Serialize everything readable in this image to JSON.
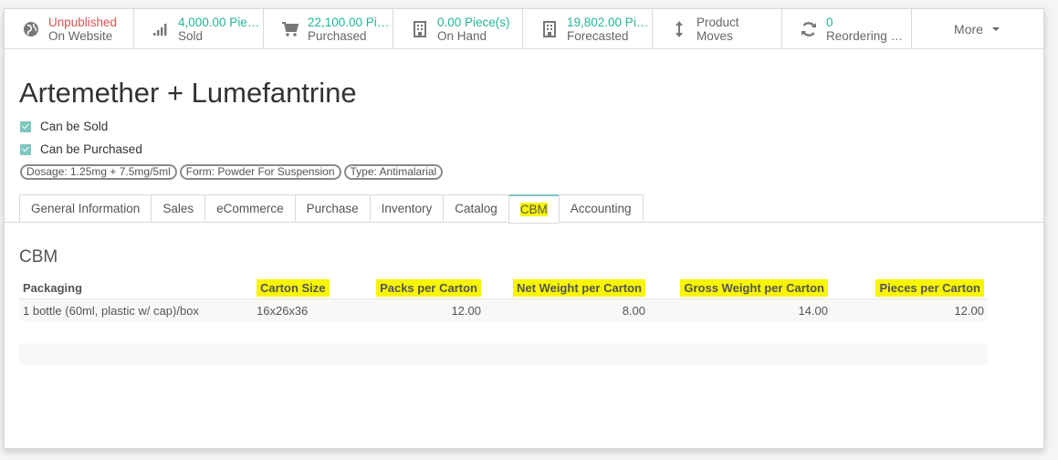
{
  "smart_buttons": [
    {
      "value": "Unpublished",
      "label": "On Website",
      "icon": "globe-icon",
      "value_color": "red"
    },
    {
      "value": "4,000.00 Piec…",
      "label": "Sold",
      "icon": "signal-icon",
      "value_color": "green"
    },
    {
      "value": "22,100.00 Pie…",
      "label": "Purchased",
      "icon": "cart-icon",
      "value_color": "green"
    },
    {
      "value": "0.00 Piece(s)",
      "label": "On Hand",
      "icon": "building-icon",
      "value_color": "green"
    },
    {
      "value": "19,802.00 Pie…",
      "label": "Forecasted",
      "icon": "building-icon",
      "value_color": "green"
    },
    {
      "value": "Product",
      "label": "Moves",
      "icon": "arrows-vertical-icon",
      "value_color": "grey"
    },
    {
      "value": "0",
      "label": "Reordering R…",
      "icon": "refresh-icon",
      "value_color": "green"
    }
  ],
  "more_label": "More",
  "product": {
    "name": "Artemether + Lumefantrine",
    "can_be_sold": "Can be Sold",
    "can_be_purchased": "Can be Purchased",
    "tags": [
      "Dosage: 1.25mg + 7.5mg/5ml",
      "Form: Powder For Suspension",
      "Type: Antimalarial"
    ]
  },
  "tabs": [
    "General Information",
    "Sales",
    "eCommerce",
    "Purchase",
    "Inventory",
    "Catalog",
    "CBM",
    "Accounting"
  ],
  "active_tab": "CBM",
  "cbm": {
    "section_title": "CBM",
    "headers": [
      "Packaging",
      "Carton Size",
      "Packs per Carton",
      "Net Weight per Carton",
      "Gross Weight per Carton",
      "Pieces per Carton"
    ],
    "rows": [
      {
        "packaging": "1 bottle (60ml, plastic w/ cap)/box",
        "carton_size": "16x26x36",
        "packs": "12.00",
        "net_weight": "8.00",
        "gross_weight": "14.00",
        "pieces": "12.00"
      }
    ]
  },
  "colors": {
    "accent": "#7ec6c1",
    "green": "#21b799",
    "red": "#d9534f",
    "highlight": "#f7f500"
  }
}
